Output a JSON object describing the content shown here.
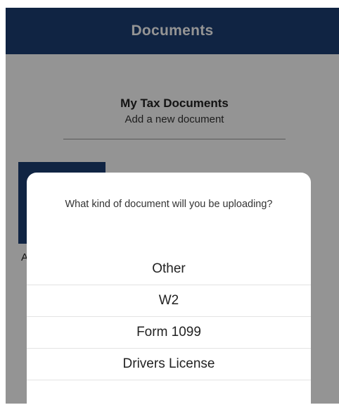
{
  "header": {
    "title": "Documents"
  },
  "main": {
    "section_title": "My Tax Documents",
    "section_subtitle": "Add a new document",
    "tile_label": "Ac"
  },
  "sheet": {
    "prompt": "What kind of document will you be uploading?",
    "options": [
      {
        "label": "Other"
      },
      {
        "label": "W2"
      },
      {
        "label": "Form 1099"
      },
      {
        "label": "Drivers License"
      }
    ]
  },
  "colors": {
    "brand": "#1c3f74",
    "overlay": "rgba(0,0,0,0.42)",
    "sheet": "#ffffff"
  }
}
